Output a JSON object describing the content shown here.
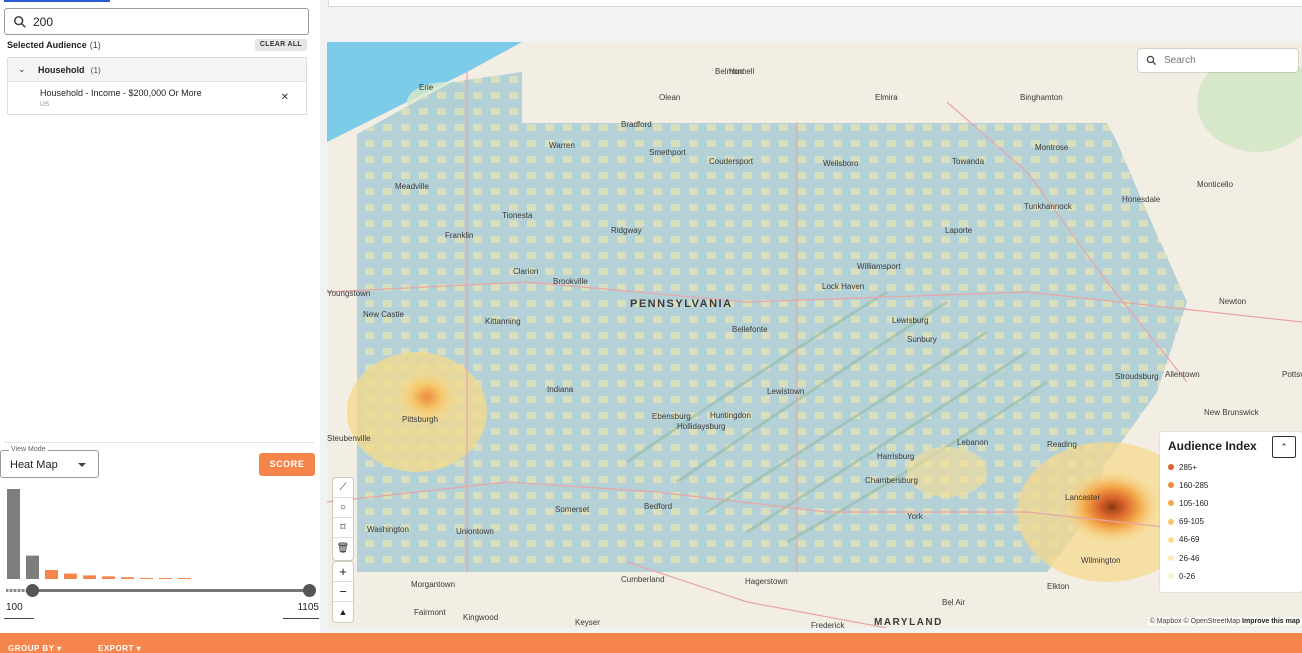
{
  "search": {
    "value": "200"
  },
  "selected": {
    "title": "Selected Audience",
    "count": "(1)",
    "clear_label": "CLEAR ALL"
  },
  "group": {
    "name": "Household",
    "count": "(1)",
    "item_name": "Household - Income - $200,000 Or More",
    "item_sub": "US"
  },
  "view_mode": {
    "label": "View Mode",
    "value": "Heat Map"
  },
  "score_label": "SCORE",
  "range": {
    "min": "100",
    "max": "1105"
  },
  "histogram": {
    "values": [
      100,
      26,
      10,
      6,
      4,
      3,
      2,
      1,
      1,
      0.5
    ]
  },
  "map": {
    "search_placeholder": "Search",
    "state_label": "PENNSYLVANIA",
    "state_label_2": "MARYLAND",
    "cities": [
      "Hornell",
      "Belmont",
      "Olean",
      "Elmira",
      "Binghamton",
      "Erie",
      "Bradford",
      "Smethport",
      "Coudersport",
      "Wellsboro",
      "Towanda",
      "Montrose",
      "Warren",
      "Meadville",
      "Tionesta",
      "Franklin",
      "Ridgway",
      "Tunkhannock",
      "Laporte",
      "Honesdale",
      "Monticello",
      "Clarion",
      "Brookville",
      "Williamsport",
      "Lock Haven",
      "Newton",
      "New Castle",
      "Kittanning",
      "Bellefonte",
      "Lewisburg",
      "Sunbury",
      "Pottsville",
      "Stroudsburg",
      "Indiana",
      "Lewistown",
      "Allentown",
      "Pittsburgh",
      "Ebensburg",
      "Huntingdon",
      "Hollidaysburg",
      "Harrisburg",
      "Lebanon",
      "Reading",
      "New Brunswick",
      "Steubenville",
      "Somerset",
      "Bedford",
      "Chambersburg",
      "York",
      "Lancaster",
      "Washington",
      "Uniontown",
      "Cumberland",
      "Hagerstown",
      "Morgantown",
      "Wilmington",
      "Fairmont",
      "Kingwood",
      "Keyser",
      "Frederick",
      "Bel Air",
      "Elkton",
      "Youngstown"
    ],
    "attribution": "© Mapbox © OpenStreetMap",
    "attribution_link": "Improve this map"
  },
  "legend": {
    "title": "Audience Index",
    "items": [
      {
        "label": "285+",
        "color": "#d9622b"
      },
      {
        "label": "160-285",
        "color": "#ee8a3f"
      },
      {
        "label": "105-160",
        "color": "#f4a94a"
      },
      {
        "label": "69-105",
        "color": "#f6c76b"
      },
      {
        "label": "46-69",
        "color": "#f8de95"
      },
      {
        "label": "26-46",
        "color": "#faebb8"
      },
      {
        "label": "0-26",
        "color": "#fbf3d6"
      }
    ]
  },
  "bottom": {
    "group_by": "GROUP BY ▾",
    "export": "EXPORT ▾"
  }
}
